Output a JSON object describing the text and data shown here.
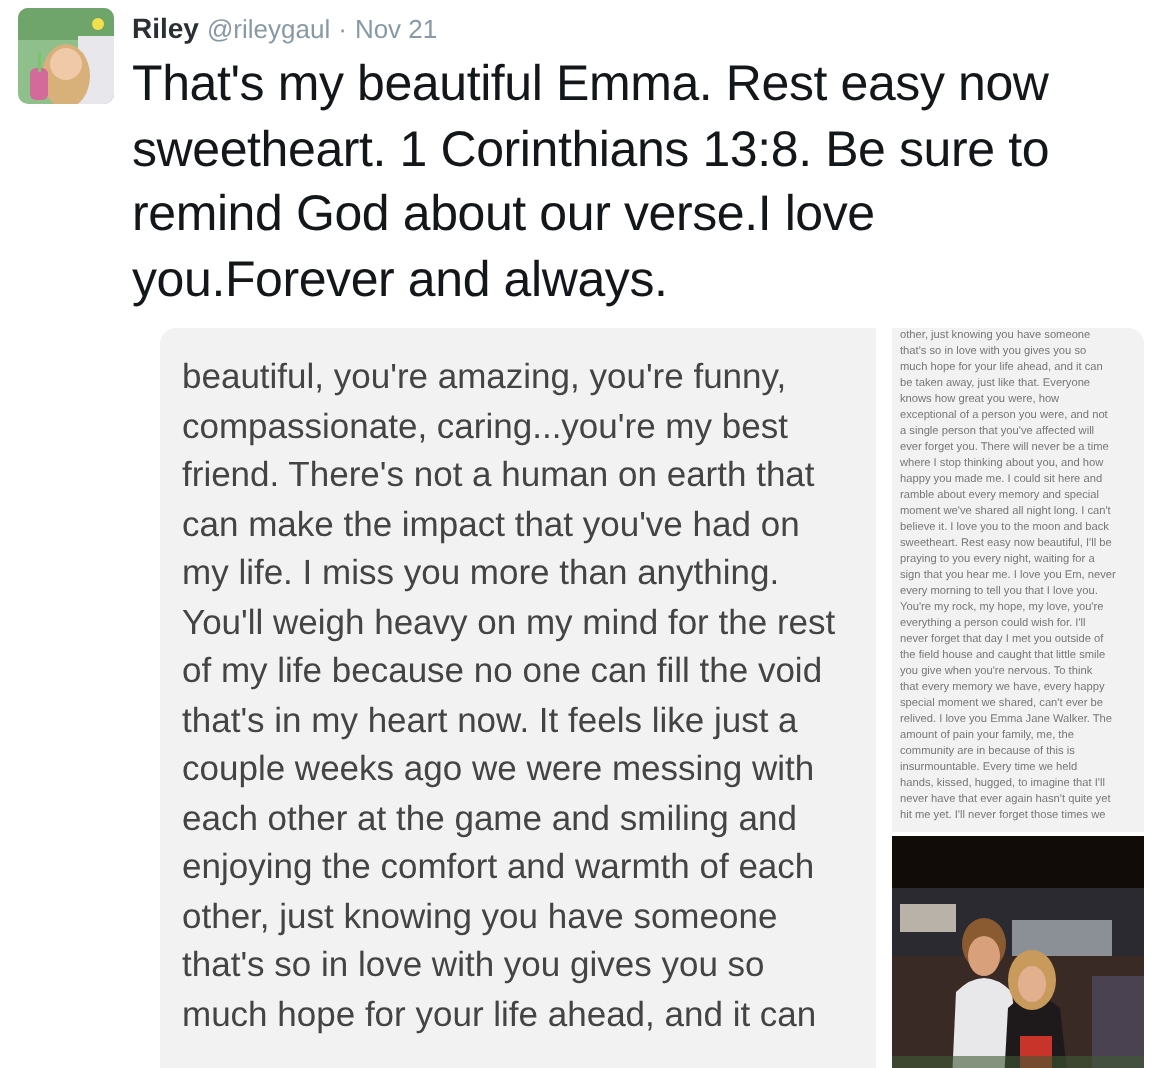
{
  "tweet": {
    "avatar": {
      "kind": "picture"
    },
    "author_name": "Riley",
    "handle": "@rileygaul",
    "separator": "·",
    "date": "Nov 21",
    "text": "That's my beautiful Emma. Rest easy now sweetheart. 1 Corinthians 13:8. Be sure to remind God about our verse.I love you.Forever and always."
  },
  "media": [
    {
      "kind": "text_image",
      "lines": [
        "beautiful, you're amazing, you're funny,",
        "compassionate, caring...you're my best",
        "friend. There's not a human on earth that",
        "can make the impact that you've had on",
        "my life. I miss you more than anything.",
        "You'll weigh heavy on my mind for the rest",
        "of my life because no one can fill the void",
        "that's in my heart now. It feels like just a",
        "couple weeks ago we were messing with",
        "each other at the game and smiling and",
        "enjoying the comfort and warmth of each",
        "other, just knowing you have someone",
        "that's so in love with you gives you so",
        "much hope for your life ahead, and it can"
      ]
    },
    {
      "kind": "text_image",
      "lines": [
        "other, just knowing you have someone",
        "that's so in love with you gives you so",
        "much hope for your life ahead, and it can",
        "be taken away, just like that. Everyone",
        "knows how great you were, how",
        "exceptional of a person you were, and not",
        "a single person that you've affected will",
        "ever forget you. There will never be a time",
        "where I stop thinking about you, and how",
        "happy you made me. I could sit here and",
        "ramble about every memory and special",
        "moment we've shared all night long. I can't",
        "believe it. I love you to the moon and back",
        "sweetheart. Rest easy now beautiful, I'll be",
        "praying to you every night, waiting for a",
        "sign that you hear me. I love you Em, never",
        "every morning to tell you that I love you.",
        "You're my rock, my hope, my love, you're",
        "everything a person could wish for. I'll",
        "never forget that day I met you outside of",
        "the field house and caught that little smile",
        "you give when you're nervous. To think",
        "that every memory we have, every happy",
        "special moment we shared, can't ever be",
        "relived. I love you Emma Jane Walker. The",
        "amount of pain your family, me, the",
        "community are in because of this is",
        "insurmountable. Every time we held",
        "hands, kissed, hugged, to imagine that I'll",
        "never have that ever again hasn't quite yet",
        "hit me yet. I'll never forget those times we"
      ]
    },
    {
      "kind": "picture"
    }
  ]
}
